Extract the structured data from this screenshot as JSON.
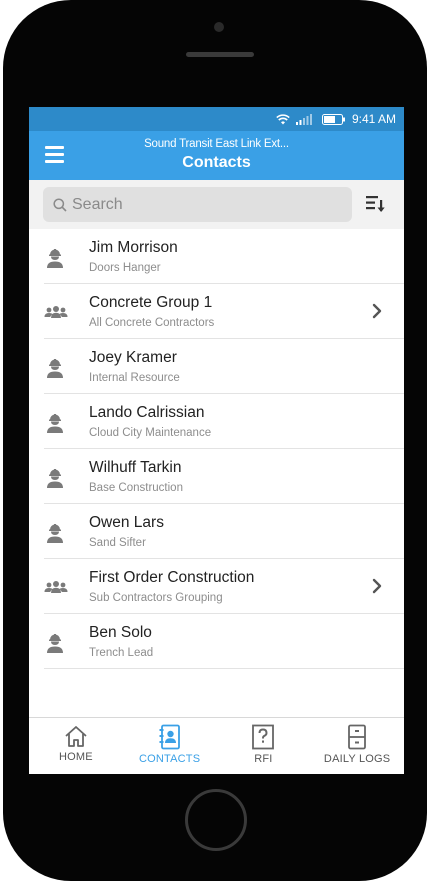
{
  "status_bar": {
    "time": "9:41 AM"
  },
  "header": {
    "project": "Sound Transit East Link Ext...",
    "title": "Contacts"
  },
  "search": {
    "placeholder": "Search",
    "value": ""
  },
  "contacts": [
    {
      "name": "Jim Morrison",
      "detail": "Doors Hanger",
      "type": "person-icon"
    },
    {
      "name": "Concrete Group 1",
      "detail": "All Concrete Contractors",
      "type": "group-icon"
    },
    {
      "name": "Joey Kramer",
      "detail": "Internal Resource",
      "type": "person-icon"
    },
    {
      "name": "Lando Calrissian",
      "detail": "Cloud City Maintenance",
      "type": "person-icon"
    },
    {
      "name": "Wilhuff Tarkin",
      "detail": "Base Construction",
      "type": "person-icon"
    },
    {
      "name": "Owen Lars",
      "detail": "Sand Sifter",
      "type": "person-icon"
    },
    {
      "name": "First Order Construction",
      "detail": "Sub Contractors Grouping",
      "type": "group-icon"
    },
    {
      "name": "Ben Solo",
      "detail": "Trench Lead",
      "type": "person-icon"
    }
  ],
  "tabs": [
    {
      "label": "HOME",
      "icon": "home-icon",
      "active": false
    },
    {
      "label": "CONTACTS",
      "icon": "contacts-icon",
      "active": true
    },
    {
      "label": "RFI",
      "icon": "rfi-icon",
      "active": false
    },
    {
      "label": "DAILY LOGS",
      "icon": "daily-logs-icon",
      "active": false
    }
  ],
  "colors": {
    "status_bar": "#2d8ac9",
    "nav_bar": "#3aa0e6",
    "accent": "#3aa0e6",
    "icon_gray": "#7a7a7a"
  }
}
